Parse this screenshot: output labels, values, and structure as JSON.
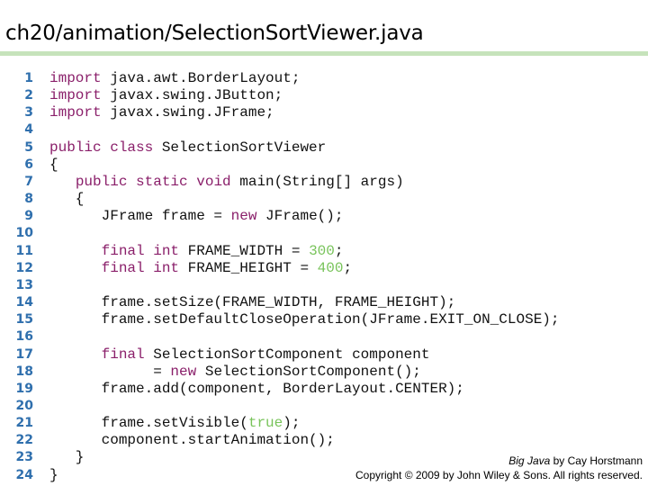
{
  "title": "ch20/animation/SelectionSortViewer.java",
  "colors": {
    "rule": "#c6e3bb",
    "line_number": "#2f6fad",
    "keyword": "#8a1f6a",
    "literal": "#78c35a",
    "text": "#111111"
  },
  "code_lines": [
    {
      "n": "1",
      "tokens": [
        [
          "kw",
          "import"
        ],
        [
          "t",
          " java.awt.BorderLayout;"
        ]
      ]
    },
    {
      "n": "2",
      "tokens": [
        [
          "kw",
          "import"
        ],
        [
          "t",
          " javax.swing.JButton;"
        ]
      ]
    },
    {
      "n": "3",
      "tokens": [
        [
          "kw",
          "import"
        ],
        [
          "t",
          " javax.swing.JFrame;"
        ]
      ]
    },
    {
      "n": "4",
      "tokens": []
    },
    {
      "n": "5",
      "tokens": [
        [
          "kw",
          "public class"
        ],
        [
          "t",
          " SelectionSortViewer"
        ]
      ]
    },
    {
      "n": "6",
      "tokens": [
        [
          "t",
          "{"
        ]
      ]
    },
    {
      "n": "7",
      "tokens": [
        [
          "t",
          "   "
        ],
        [
          "kw",
          "public static void"
        ],
        [
          "t",
          " main(String[] args)"
        ]
      ]
    },
    {
      "n": "8",
      "tokens": [
        [
          "t",
          "   {"
        ]
      ]
    },
    {
      "n": "9",
      "tokens": [
        [
          "t",
          "      JFrame frame = "
        ],
        [
          "kw",
          "new"
        ],
        [
          "t",
          " JFrame();"
        ]
      ]
    },
    {
      "n": "10",
      "tokens": []
    },
    {
      "n": "11",
      "tokens": [
        [
          "t",
          "      "
        ],
        [
          "kw",
          "final int"
        ],
        [
          "t",
          " FRAME_WIDTH = "
        ],
        [
          "num",
          "300"
        ],
        [
          "t",
          ";"
        ]
      ]
    },
    {
      "n": "12",
      "tokens": [
        [
          "t",
          "      "
        ],
        [
          "kw",
          "final int"
        ],
        [
          "t",
          " FRAME_HEIGHT = "
        ],
        [
          "num",
          "400"
        ],
        [
          "t",
          ";"
        ]
      ]
    },
    {
      "n": "13",
      "tokens": []
    },
    {
      "n": "14",
      "tokens": [
        [
          "t",
          "      frame.setSize(FRAME_WIDTH, FRAME_HEIGHT);"
        ]
      ]
    },
    {
      "n": "15",
      "tokens": [
        [
          "t",
          "      frame.setDefaultCloseOperation(JFrame.EXIT_ON_CLOSE);"
        ]
      ]
    },
    {
      "n": "16",
      "tokens": []
    },
    {
      "n": "17",
      "tokens": [
        [
          "t",
          "      "
        ],
        [
          "kw",
          "final"
        ],
        [
          "t",
          " SelectionSortComponent component"
        ]
      ]
    },
    {
      "n": "18",
      "tokens": [
        [
          "t",
          "            = "
        ],
        [
          "kw",
          "new"
        ],
        [
          "t",
          " SelectionSortComponent();"
        ]
      ]
    },
    {
      "n": "19",
      "tokens": [
        [
          "t",
          "      frame.add(component, BorderLayout.CENTER);"
        ]
      ]
    },
    {
      "n": "20",
      "tokens": []
    },
    {
      "n": "21",
      "tokens": [
        [
          "t",
          "      frame.setVisible("
        ],
        [
          "num",
          "true"
        ],
        [
          "t",
          ");"
        ]
      ]
    },
    {
      "n": "22",
      "tokens": [
        [
          "t",
          "      component.startAnimation();"
        ]
      ]
    },
    {
      "n": "23",
      "tokens": [
        [
          "t",
          "   }"
        ]
      ]
    },
    {
      "n": "24",
      "tokens": [
        [
          "t",
          "}"
        ]
      ]
    }
  ],
  "footer": {
    "book_title": "Big Java",
    "author_text": " by Cay Horstmann",
    "copyright": "Copyright © 2009 by John Wiley & Sons.  All rights reserved."
  }
}
